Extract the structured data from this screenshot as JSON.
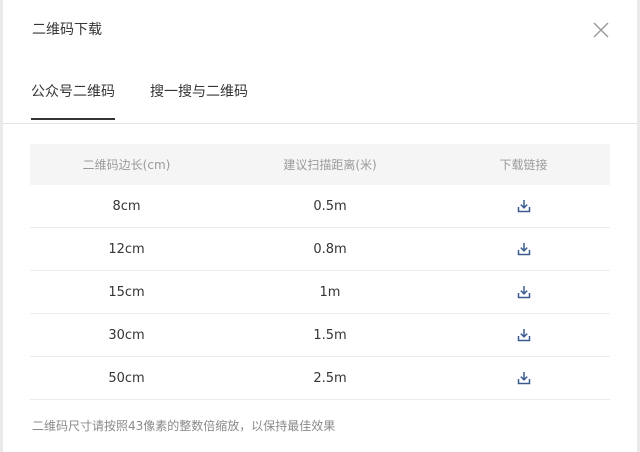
{
  "dialog": {
    "title": "二维码下载"
  },
  "tabs": [
    {
      "label": "公众号二维码",
      "active": true
    },
    {
      "label": "搜一搜与二维码",
      "active": false
    }
  ],
  "table": {
    "headers": [
      "二维码边长(cm)",
      "建议扫描距离(米)",
      "下载链接"
    ],
    "rows": [
      {
        "size": "8cm",
        "distance": "0.5m"
      },
      {
        "size": "12cm",
        "distance": "0.8m"
      },
      {
        "size": "15cm",
        "distance": "1m"
      },
      {
        "size": "30cm",
        "distance": "1.5m"
      },
      {
        "size": "50cm",
        "distance": "2.5m"
      }
    ],
    "download_icon": "download-icon"
  },
  "note": "二维码尺寸请按照43像素的整数倍缩放，以保持最佳效果",
  "colors": {
    "download_icon": "#3a5c8f",
    "header_bg": "#f5f5f6",
    "text": "#353535"
  }
}
